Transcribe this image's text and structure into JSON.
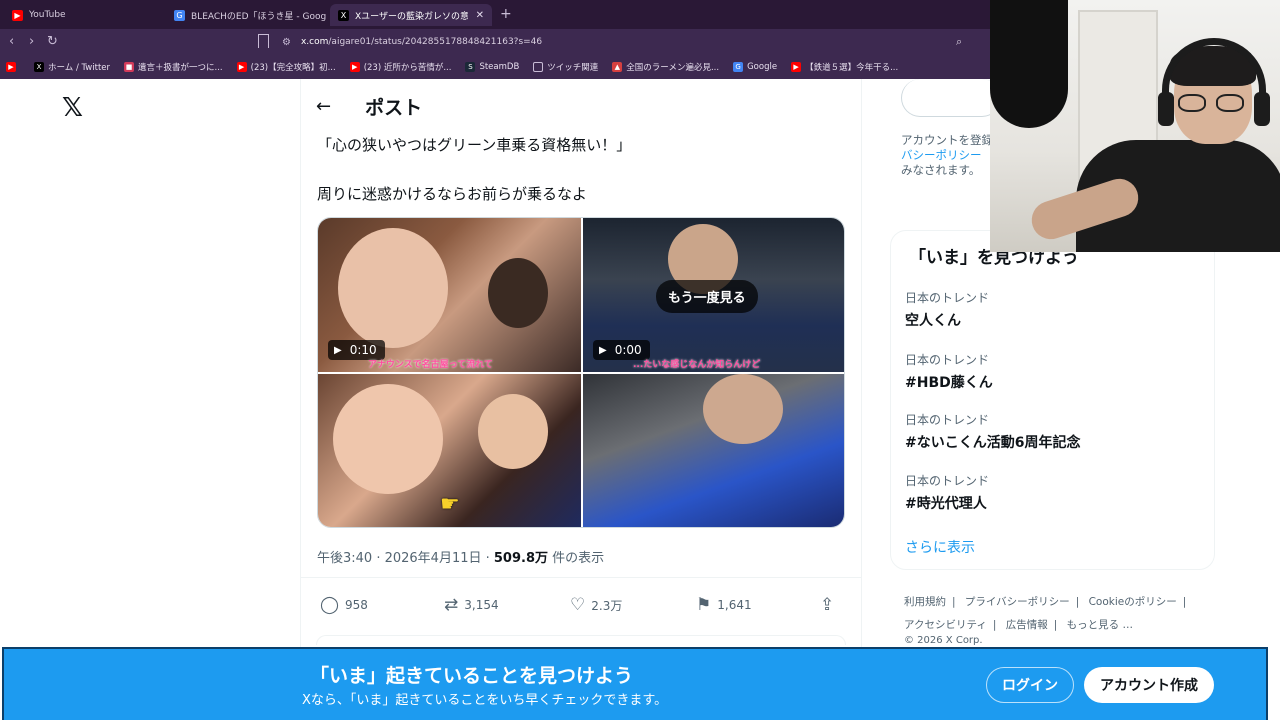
{
  "browser": {
    "tabs": [
      {
        "title": "YouTube",
        "icon": "youtube-icon",
        "color": "#ff0000"
      },
      {
        "title": "BLEACHのED「ほうき星 - Google 検索",
        "icon": "google-icon",
        "color": "#4285f4"
      },
      {
        "title": "Xユーザーの藍染ガレソの意報（兼滅",
        "icon": "x-icon",
        "color": "#000000"
      }
    ],
    "url_host": "x.com",
    "url_path": "/aigare01/status/2042855178848421163?s=46",
    "bookmarks": [
      {
        "label": "ホーム / Twitter",
        "icon": "x-icon",
        "color": "#000000"
      },
      {
        "label": "遺言＋扱書が一つに...",
        "icon": "bookmark-red-icon",
        "color": "#d23a5a"
      },
      {
        "label": "(23)【完全攻略】初...",
        "icon": "youtube-icon",
        "color": "#ff0000"
      },
      {
        "label": "(23) 近所から苦情が...",
        "icon": "youtube-icon",
        "color": "#ff0000"
      },
      {
        "label": "SteamDB",
        "icon": "steamdb-icon",
        "color": "#1b2838"
      },
      {
        "label": "ツイッチ関連",
        "icon": "folder-icon",
        "color": "#c9bcd6"
      },
      {
        "label": "全国のラーメン遍必見...",
        "icon": "ramen-icon",
        "color": "#d64040"
      },
      {
        "label": "Google",
        "icon": "google-icon",
        "color": "#4285f4"
      },
      {
        "label": "【鉄道５選】今年干る...",
        "icon": "youtube-icon",
        "color": "#ff0000"
      }
    ]
  },
  "post": {
    "header_title": "ポスト",
    "text_line1": "「心の狭いやつはグリーン車乗る資格無い！」",
    "text_line2": "周りに迷惑かけるならお前らが乗るなよ",
    "media": {
      "video1_duration": "0:10",
      "video2_duration": "0:00",
      "replay_label": "もう一度見る",
      "caption1": "アナウンスで名古屋って流れて",
      "caption2": "...たいな感じなんか知らんけど"
    },
    "time": "午後3:40 · 2026年4月11日 · ",
    "views_count": "509.8万",
    "views_label": " 件の表示",
    "stats": {
      "replies": "958",
      "reposts": "3,154",
      "likes": "2.3万",
      "bookmarks": "1,641"
    }
  },
  "sidebar": {
    "note_line1": "アカウントを登録",
    "note_link": "バシーポリシー",
    "note_line3": "みなされます。",
    "trends_title": "「いま」を見つけよう",
    "trends": [
      {
        "category": "日本のトレンド",
        "name": "空人くん"
      },
      {
        "category": "日本のトレンド",
        "name": "#HBD藤くん"
      },
      {
        "category": "日本のトレンド",
        "name": "#ないこくん活動6周年記念"
      },
      {
        "category": "日本のトレンド",
        "name": "#時光代理人"
      }
    ],
    "show_more": "さらに表示",
    "footer": [
      "利用規約",
      "プライバシーポリシー",
      "Cookieのポリシー",
      "アクセシビリティ",
      "広告情報",
      "もっと見る …"
    ],
    "copyright": "© 2026 X Corp."
  },
  "banner": {
    "title": "「いま」起きていることを見つけよう",
    "subtitle": "Xなら、「いま」起きていることをいち早くチェックできます。",
    "login": "ログイン",
    "signup": "アカウント作成",
    "color": "#1d9bf0"
  }
}
